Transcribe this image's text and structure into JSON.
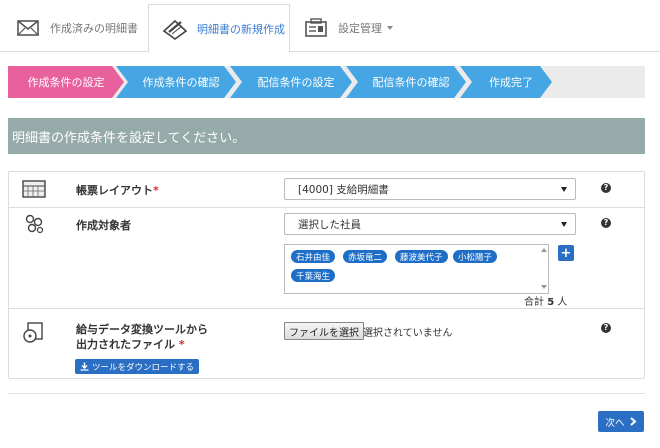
{
  "tabs": [
    {
      "label": "作成済みの明細書",
      "icon": "envelope-icon",
      "active": false
    },
    {
      "label": "明細書の新規作成",
      "icon": "pen-document-icon",
      "active": true
    },
    {
      "label": "設定管理",
      "icon": "settings-folder-icon",
      "active": false
    }
  ],
  "steps": [
    {
      "label": "作成条件の設定",
      "active": true
    },
    {
      "label": "作成条件の確認",
      "active": false
    },
    {
      "label": "配信条件の設定",
      "active": false
    },
    {
      "label": "配信条件の確認",
      "active": false
    },
    {
      "label": "作成完了",
      "active": false
    }
  ],
  "colors": {
    "step_active": "#e8609c",
    "step_inactive": "#46a6e3",
    "step_track": "#ebebeb",
    "banner": "#97aaaa",
    "primary": "#2a6fc4"
  },
  "banner": {
    "text": "明細書の作成条件を設定してください。"
  },
  "form": {
    "layout": {
      "label": "帳票レイアウト",
      "required": "*",
      "value": "[4000] 支給明細書"
    },
    "target": {
      "label": "作成対象者",
      "value": "選択した社員",
      "employees": [
        "石井由佳",
        "赤坂竜二",
        "藤波美代子",
        "小松陽子",
        "千葉海生"
      ],
      "total_prefix": "合計",
      "total_count": "5",
      "total_unit": "人"
    },
    "file": {
      "label_line1": "給与データ変換ツールから",
      "label_line2": "出力されたファイル",
      "required": "*",
      "button_label": "ファイルを選択",
      "status": "選択されていません",
      "download_label": "ツールをダウンロードする"
    },
    "help_glyph": "?"
  },
  "next": {
    "label": "次へ"
  }
}
